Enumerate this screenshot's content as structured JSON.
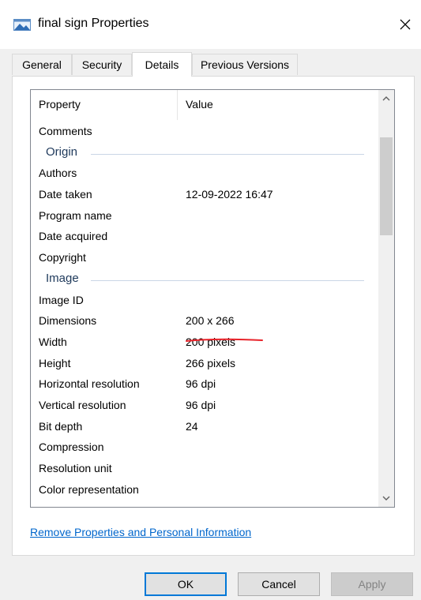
{
  "window": {
    "title": "final sign Properties"
  },
  "tabs": [
    {
      "label": "General"
    },
    {
      "label": "Security"
    },
    {
      "label": "Details"
    },
    {
      "label": "Previous Versions"
    }
  ],
  "details": {
    "columns": {
      "property": "Property",
      "value": "Value"
    },
    "rows": [
      {
        "type": "item",
        "property": "Comments",
        "value": ""
      },
      {
        "type": "group",
        "property": "Origin",
        "value": ""
      },
      {
        "type": "item",
        "property": "Authors",
        "value": ""
      },
      {
        "type": "item",
        "property": "Date taken",
        "value": "12-09-2022 16:47"
      },
      {
        "type": "item",
        "property": "Program name",
        "value": ""
      },
      {
        "type": "item",
        "property": "Date acquired",
        "value": ""
      },
      {
        "type": "item",
        "property": "Copyright",
        "value": ""
      },
      {
        "type": "group",
        "property": "Image",
        "value": ""
      },
      {
        "type": "item",
        "property": "Image ID",
        "value": ""
      },
      {
        "type": "item",
        "property": "Dimensions",
        "value": "200 x 266"
      },
      {
        "type": "item",
        "property": "Width",
        "value": "200 pixels"
      },
      {
        "type": "item",
        "property": "Height",
        "value": "266 pixels"
      },
      {
        "type": "item",
        "property": "Horizontal resolution",
        "value": "96 dpi"
      },
      {
        "type": "item",
        "property": "Vertical resolution",
        "value": "96 dpi"
      },
      {
        "type": "item",
        "property": "Bit depth",
        "value": "24"
      },
      {
        "type": "item",
        "property": "Compression",
        "value": ""
      },
      {
        "type": "item",
        "property": "Resolution unit",
        "value": ""
      },
      {
        "type": "item",
        "property": "Color representation",
        "value": ""
      }
    ]
  },
  "link": {
    "label": "Remove Properties and Personal Information"
  },
  "buttons": {
    "ok": "OK",
    "cancel": "Cancel",
    "apply": "Apply"
  },
  "colors": {
    "accent": "#0078d7",
    "link": "#0066cc",
    "annotation": "#e8232a",
    "group_heading": "#1e395b"
  },
  "icons": {
    "title_icon": "image-file-icon",
    "close": "close-icon",
    "scroll_up": "chevron-up-icon",
    "scroll_down": "chevron-down-icon"
  }
}
